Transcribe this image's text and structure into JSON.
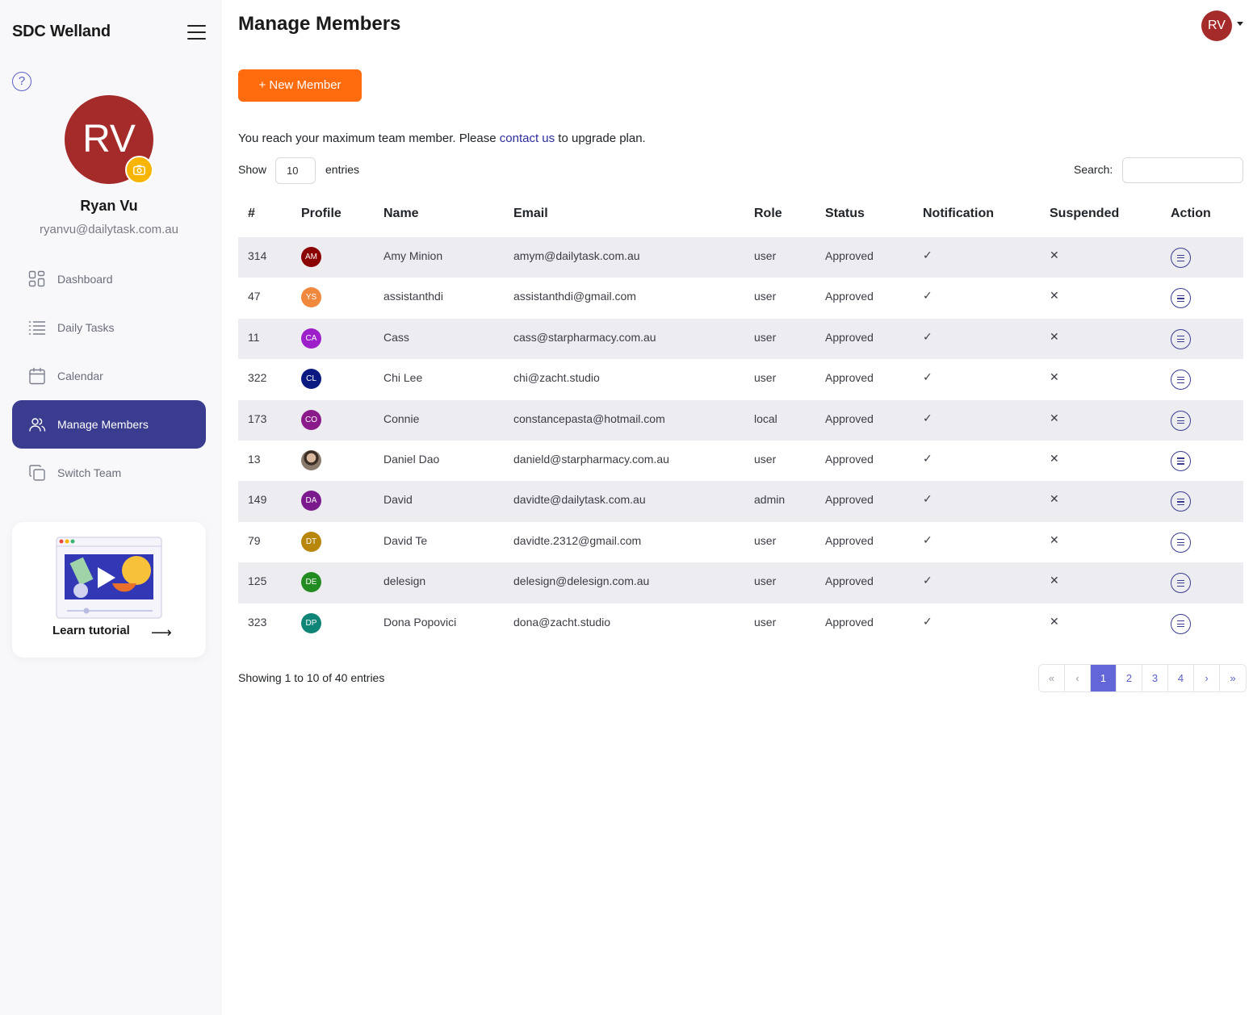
{
  "sidebar": {
    "brand": "SDC Welland",
    "avatar_initials": "RV",
    "user_name": "Ryan Vu",
    "user_email": "ryanvu@dailytask.com.au",
    "nav": [
      {
        "label": "Dashboard",
        "icon": "grid-icon",
        "active": false
      },
      {
        "label": "Daily Tasks",
        "icon": "list-icon",
        "active": false
      },
      {
        "label": "Calendar",
        "icon": "calendar-icon",
        "active": false
      },
      {
        "label": "Manage Members",
        "icon": "users-icon",
        "active": true
      },
      {
        "label": "Switch Team",
        "icon": "copy-icon",
        "active": false
      }
    ],
    "tutorial_label": "Learn tutorial"
  },
  "header": {
    "title": "Manage Members",
    "avatar_initials": "RV"
  },
  "actions": {
    "new_member_label": "+ New Member"
  },
  "notice": {
    "before": "You reach your maximum team member. Please ",
    "link": "contact us",
    "after": " to upgrade plan."
  },
  "table_controls": {
    "show_label": "Show",
    "page_size": "10",
    "entries_label": "entries",
    "search_label": "Search:",
    "search_value": ""
  },
  "table": {
    "columns": [
      "#",
      "Profile",
      "Name",
      "Email",
      "Role",
      "Status",
      "Notification",
      "Suspended",
      "Action"
    ],
    "rows": [
      {
        "id": "314",
        "initials": "AM",
        "color": "#8b0000",
        "name": "Amy Minion",
        "email": "amym@dailytask.com.au",
        "role": "user",
        "status": "Approved",
        "notification": "✓",
        "suspended": "✕"
      },
      {
        "id": "47",
        "initials": "YS",
        "color": "#f0883e",
        "name": "assistanthdi",
        "email": "assistanthdi@gmail.com",
        "role": "user",
        "status": "Approved",
        "notification": "✓",
        "suspended": "✕"
      },
      {
        "id": "11",
        "initials": "CA",
        "color": "#9c1fc9",
        "name": "Cass",
        "email": "cass@starpharmacy.com.au",
        "role": "user",
        "status": "Approved",
        "notification": "✓",
        "suspended": "✕"
      },
      {
        "id": "322",
        "initials": "CL",
        "color": "#0b1a80",
        "name": "Chi Lee",
        "email": "chi@zacht.studio",
        "role": "user",
        "status": "Approved",
        "notification": "✓",
        "suspended": "✕"
      },
      {
        "id": "173",
        "initials": "CO",
        "color": "#8a1a8a",
        "name": "Connie",
        "email": "constancepasta@hotmail.com",
        "role": "local",
        "status": "Approved",
        "notification": "✓",
        "suspended": "✕"
      },
      {
        "id": "13",
        "initials": "",
        "color": "#6b5a4a",
        "name": "Daniel Dao",
        "email": "danield@starpharmacy.com.au",
        "role": "user",
        "status": "Approved",
        "notification": "✓",
        "suspended": "✕"
      },
      {
        "id": "149",
        "initials": "DA",
        "color": "#7a1a8c",
        "name": "David",
        "email": "davidte@dailytask.com.au",
        "role": "admin",
        "status": "Approved",
        "notification": "✓",
        "suspended": "✕"
      },
      {
        "id": "79",
        "initials": "DT",
        "color": "#b8860b",
        "name": "David Te",
        "email": "davidte.2312@gmail.com",
        "role": "user",
        "status": "Approved",
        "notification": "✓",
        "suspended": "✕"
      },
      {
        "id": "125",
        "initials": "DE",
        "color": "#228b22",
        "name": "delesign",
        "email": "delesign@delesign.com.au",
        "role": "user",
        "status": "Approved",
        "notification": "✓",
        "suspended": "✕"
      },
      {
        "id": "323",
        "initials": "DP",
        "color": "#0f8578",
        "name": "Dona Popovici",
        "email": "dona@zacht.studio",
        "role": "user",
        "status": "Approved",
        "notification": "✓",
        "suspended": "✕"
      }
    ]
  },
  "footer": {
    "showing": "Showing 1 to 10 of 40 entries",
    "pages": [
      "«",
      "‹",
      "1",
      "2",
      "3",
      "4",
      "›",
      "»"
    ],
    "active_page": "1"
  },
  "colors": {
    "accent": "#3a3c8f",
    "button": "#ff6b0d",
    "avatar": "#a52a2a",
    "page_active": "#6266d6"
  }
}
